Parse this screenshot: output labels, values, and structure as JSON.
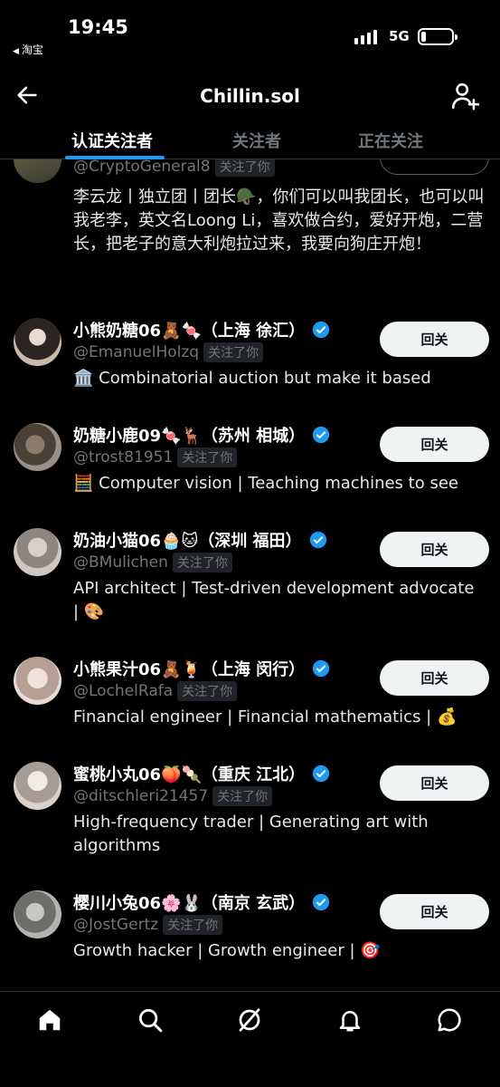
{
  "status_bar": {
    "time": "19:45",
    "back_app": "淘宝",
    "network": "5G"
  },
  "header": {
    "title": "Chillin.sol"
  },
  "tabs": [
    {
      "label": "认证关注者",
      "active": true
    },
    {
      "label": "关注者",
      "active": false
    },
    {
      "label": "正在关注",
      "active": false
    }
  ],
  "follows_you_label": "关注了你",
  "top_partial": {
    "handle": "@CryptoGeneral8",
    "bio": "李云龙丨独立团丨团长🪖，你们可以叫我团长，也可以叫我老李，英文名Loong Li，喜欢做合约，爱好开炮，二营长，把老子的意大利炮拉过来，我要向狗庄开炮！"
  },
  "users": [
    {
      "name": "小熊奶糖06🧸🍬（上海 徐汇）",
      "handle": "@EmanuelHolzq",
      "bio": "🏛️ Combinatorial auction but make it based",
      "button": "回关"
    },
    {
      "name": "奶糖小鹿09🍬🦌（苏州 相城）",
      "handle": "@trost81951",
      "bio": "🧮 Computer vision | Teaching machines to see",
      "button": "回关"
    },
    {
      "name": "奶油小猫06🧁🐱（深圳 福田）",
      "handle": "@BMulichen",
      "bio": "API architect | Test-driven development advocate | 🎨",
      "button": "回关"
    },
    {
      "name": "小熊果汁06🧸🍹（上海 闵行）",
      "handle": "@LochelRafa",
      "bio": "Financial engineer | Financial mathematics | 💰",
      "button": "回关"
    },
    {
      "name": "蜜桃小丸06🍑🍡（重庆 江北）",
      "handle": "@ditschleri21457",
      "bio": "High-frequency trader | Generating art with algorithms",
      "button": "回关"
    },
    {
      "name": "樱川小兔06🌸🐰（南京 玄武）",
      "handle": "@JostGertz",
      "bio": "Growth hacker | Growth engineer | 🎯",
      "button": "回关"
    }
  ],
  "colors": {
    "accent": "#1d9bf0",
    "background": "#000000",
    "secondary_text": "#71767b",
    "button_bg": "#eff3f4"
  },
  "nav_icons": [
    "home-icon",
    "search-icon",
    "grok-icon",
    "notifications-icon",
    "messages-icon"
  ]
}
